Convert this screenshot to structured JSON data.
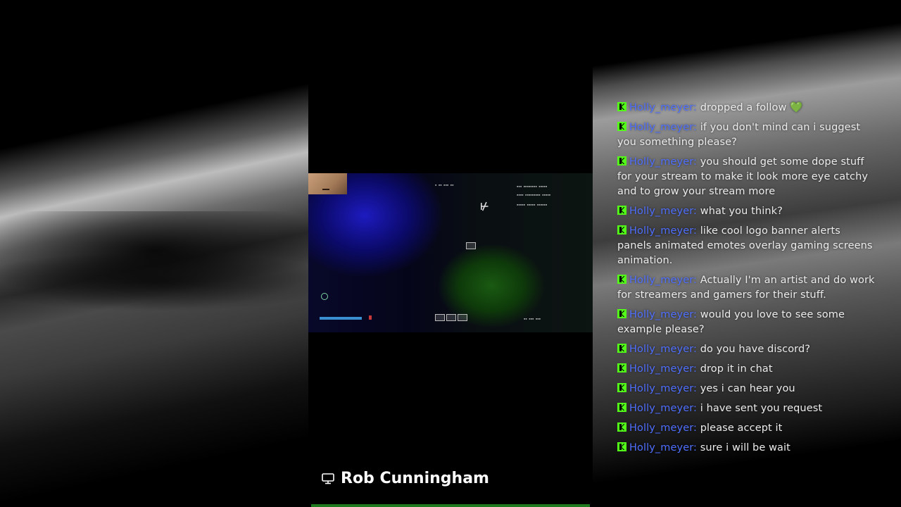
{
  "streamer": {
    "name": "Rob Cunningham",
    "icon": "monitor-icon"
  },
  "colors": {
    "username": "#4f6fff",
    "kick_badge": "#53fc18",
    "accent_line": "#1f7a1f"
  },
  "chat": {
    "messages": [
      {
        "user": "Holly_meyer",
        "text": "dropped a follow",
        "emoji": "💚"
      },
      {
        "user": "Holly_meyer",
        "text": "if you don't mind can i suggest you something please?"
      },
      {
        "user": "Holly_meyer",
        "text": "you should get some dope stuff for your stream to make it look more eye catchy and to grow your stream more"
      },
      {
        "user": "Holly_meyer",
        "text": "what you think?"
      },
      {
        "user": "Holly_meyer",
        "text": "like cool logo banner alerts panels animated emotes overlay gaming screens animation."
      },
      {
        "user": "Holly_meyer",
        "text": "Actually I'm an artist and do work for streamers and gamers for their stuff."
      },
      {
        "user": "Holly_meyer",
        "text": "would you love to see some example please?"
      },
      {
        "user": "Holly_meyer",
        "text": "do you have discord?"
      },
      {
        "user": "Holly_meyer",
        "text": "drop it in chat"
      },
      {
        "user": "Holly_meyer",
        "text": "yes i can hear you"
      },
      {
        "user": "Holly_meyer",
        "text": "i have sent you request"
      },
      {
        "user": "Holly_meyer",
        "text": "please accept it"
      },
      {
        "user": "Holly_meyer",
        "text": "sure i will be wait"
      }
    ]
  }
}
